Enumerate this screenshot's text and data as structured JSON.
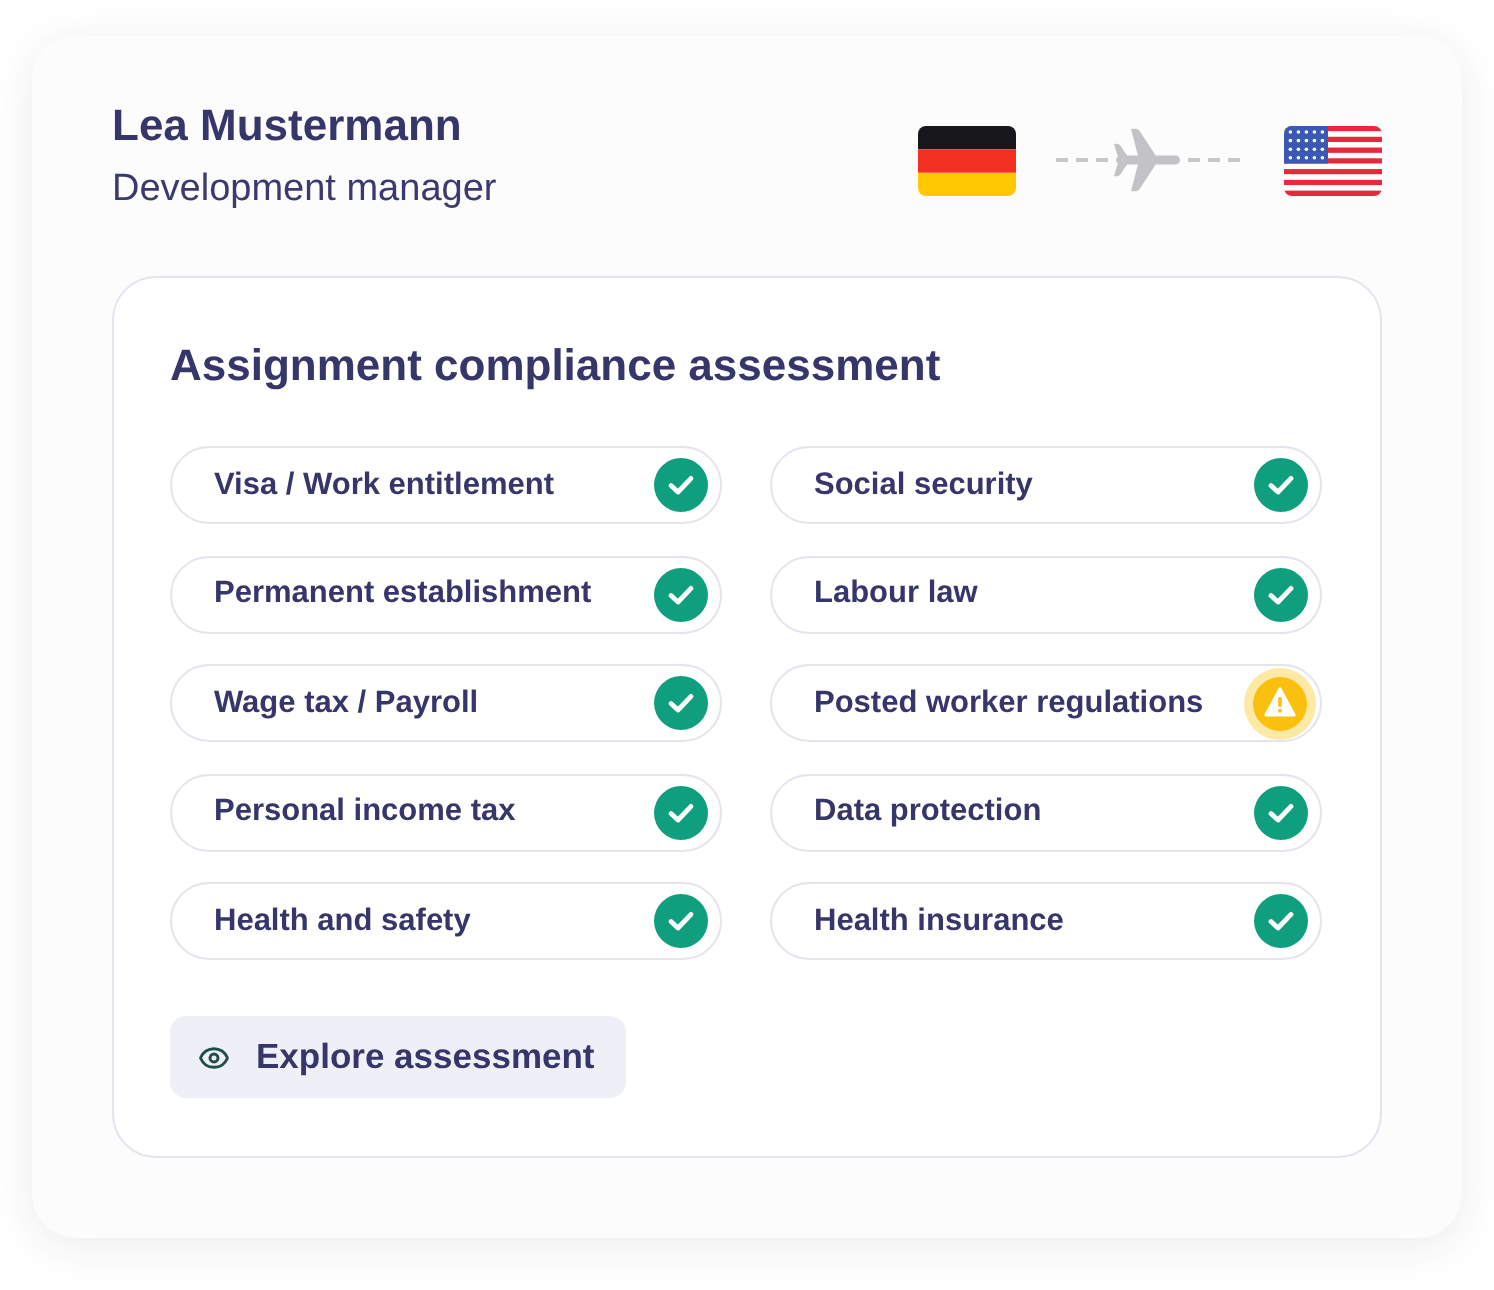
{
  "profile": {
    "name": "Lea Mustermann",
    "role": "Development manager"
  },
  "assessment": {
    "title": "Assignment compliance assessment",
    "columns": [
      {
        "items": [
          {
            "label": "Visa / Work entitlement",
            "warning": false
          },
          {
            "label": "Permanent establishment",
            "warning": false
          },
          {
            "label": "Wage tax / Payroll",
            "warning": false
          },
          {
            "label": "Personal income tax",
            "warning": false
          },
          {
            "label": "Health and safety",
            "warning": false
          }
        ]
      },
      {
        "items": [
          {
            "label": "Social security",
            "warning": false
          },
          {
            "label": "Labour law",
            "warning": false
          },
          {
            "label": "Posted worker regulations",
            "warning": true
          },
          {
            "label": "Data protection",
            "warning": false
          },
          {
            "label": "Health insurance",
            "warning": false
          }
        ]
      }
    ],
    "button": {
      "label": "Explore assessment"
    }
  }
}
